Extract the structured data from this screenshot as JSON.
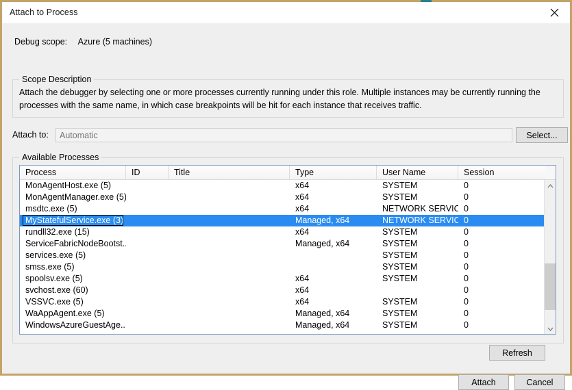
{
  "window": {
    "title": "Attach to Process",
    "close_icon": "close-icon"
  },
  "scope": {
    "label": "Debug scope:",
    "value": "Azure (5 machines)"
  },
  "scope_description": {
    "group_title": "Scope Description",
    "text": "Attach the debugger by selecting one or more processes currently running under this role.  Multiple instances may be currently running the processes with the same name, in which case breakpoints will be hit for each instance that receives traffic."
  },
  "attach_to": {
    "label": "Attach to:",
    "placeholder": "Automatic",
    "value": "",
    "select_button": "Select..."
  },
  "available_processes": {
    "group_title": "Available Processes",
    "columns": [
      {
        "key": "process",
        "label": "Process"
      },
      {
        "key": "id",
        "label": "ID"
      },
      {
        "key": "title",
        "label": "Title"
      },
      {
        "key": "type",
        "label": "Type"
      },
      {
        "key": "user",
        "label": "User Name"
      },
      {
        "key": "session",
        "label": "Session"
      }
    ],
    "rows": [
      {
        "process": "MonAgentHost.exe (5)",
        "id": "",
        "title": "",
        "type": "x64",
        "user": "SYSTEM",
        "session": "0",
        "selected": false
      },
      {
        "process": "MonAgentManager.exe (5)",
        "id": "",
        "title": "",
        "type": "x64",
        "user": "SYSTEM",
        "session": "0",
        "selected": false
      },
      {
        "process": "msdtc.exe (5)",
        "id": "",
        "title": "",
        "type": "x64",
        "user": "NETWORK SERVICE",
        "session": "0",
        "selected": false
      },
      {
        "process": "MyStatefulService.exe (3)",
        "id": "",
        "title": "",
        "type": "Managed, x64",
        "user": "NETWORK SERVICE",
        "session": "0",
        "selected": true
      },
      {
        "process": "rundll32.exe (15)",
        "id": "",
        "title": "",
        "type": "x64",
        "user": "SYSTEM",
        "session": "0",
        "selected": false
      },
      {
        "process": "ServiceFabricNodeBootst...",
        "id": "",
        "title": "",
        "type": "Managed, x64",
        "user": "SYSTEM",
        "session": "0",
        "selected": false
      },
      {
        "process": "services.exe (5)",
        "id": "",
        "title": "",
        "type": "",
        "user": "SYSTEM",
        "session": "0",
        "selected": false
      },
      {
        "process": "smss.exe (5)",
        "id": "",
        "title": "",
        "type": "",
        "user": "SYSTEM",
        "session": "0",
        "selected": false
      },
      {
        "process": "spoolsv.exe (5)",
        "id": "",
        "title": "",
        "type": "x64",
        "user": "SYSTEM",
        "session": "0",
        "selected": false
      },
      {
        "process": "svchost.exe (60)",
        "id": "",
        "title": "",
        "type": "x64",
        "user": "",
        "session": "0",
        "selected": false
      },
      {
        "process": "VSSVC.exe (5)",
        "id": "",
        "title": "",
        "type": "x64",
        "user": "SYSTEM",
        "session": "0",
        "selected": false
      },
      {
        "process": "WaAppAgent.exe (5)",
        "id": "",
        "title": "",
        "type": "Managed, x64",
        "user": "SYSTEM",
        "session": "0",
        "selected": false
      },
      {
        "process": "WindowsAzureGuestAge...",
        "id": "",
        "title": "",
        "type": "Managed, x64",
        "user": "SYSTEM",
        "session": "0",
        "selected": false
      }
    ],
    "refresh_button": "Refresh"
  },
  "footer": {
    "attach_button": "Attach",
    "cancel_button": "Cancel"
  },
  "colors": {
    "selection": "#2a8cf0",
    "window_border": "#c3a468",
    "dialog_background": "#efefef",
    "listview_border": "#7a99c0",
    "button_face": "#e1e1e1"
  }
}
